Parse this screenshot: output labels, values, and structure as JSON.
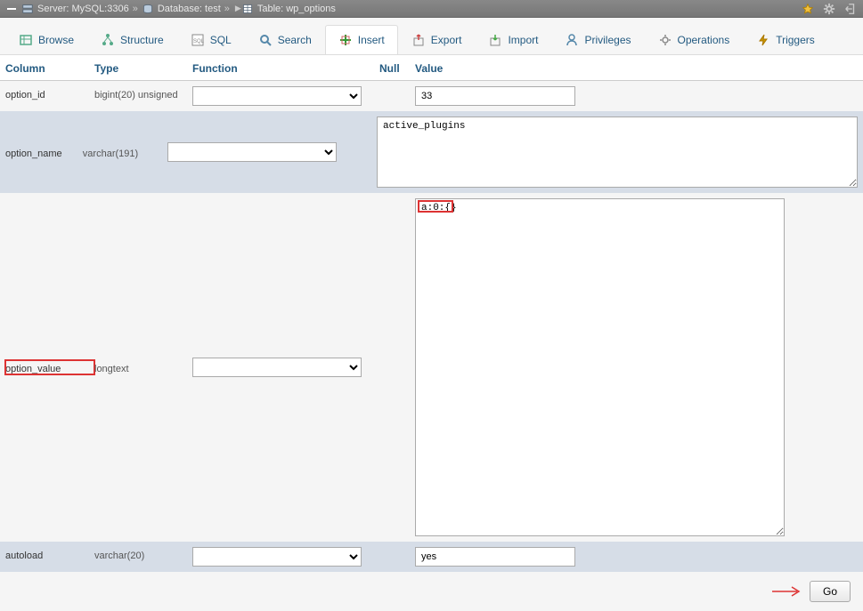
{
  "breadcrumb": {
    "server_label": "Server: MySQL:3306",
    "database_label": "Database: test",
    "table_label": "Table: wp_options"
  },
  "tabs": [
    {
      "label": "Browse",
      "icon": "browse"
    },
    {
      "label": "Structure",
      "icon": "structure"
    },
    {
      "label": "SQL",
      "icon": "sql"
    },
    {
      "label": "Search",
      "icon": "search"
    },
    {
      "label": "Insert",
      "icon": "insert"
    },
    {
      "label": "Export",
      "icon": "export"
    },
    {
      "label": "Import",
      "icon": "import"
    },
    {
      "label": "Privileges",
      "icon": "privileges"
    },
    {
      "label": "Operations",
      "icon": "operations"
    },
    {
      "label": "Triggers",
      "icon": "triggers"
    }
  ],
  "active_tab_index": 4,
  "headers": {
    "column": "Column",
    "type": "Type",
    "function": "Function",
    "null": "Null",
    "value": "Value"
  },
  "rows": [
    {
      "column": "option_id",
      "type": "bigint(20) unsigned",
      "value": "33",
      "input_kind": "text"
    },
    {
      "column": "option_name",
      "type": "varchar(191)",
      "value": "active_plugins",
      "input_kind": "textarea_small"
    },
    {
      "column": "option_value",
      "type": "longtext",
      "value": "a:0:{}",
      "input_kind": "textarea_large",
      "highlight_column": true,
      "highlight_value": true
    },
    {
      "column": "autoload",
      "type": "varchar(20)",
      "value": "yes",
      "input_kind": "text"
    }
  ],
  "footer": {
    "go_label": "Go"
  }
}
